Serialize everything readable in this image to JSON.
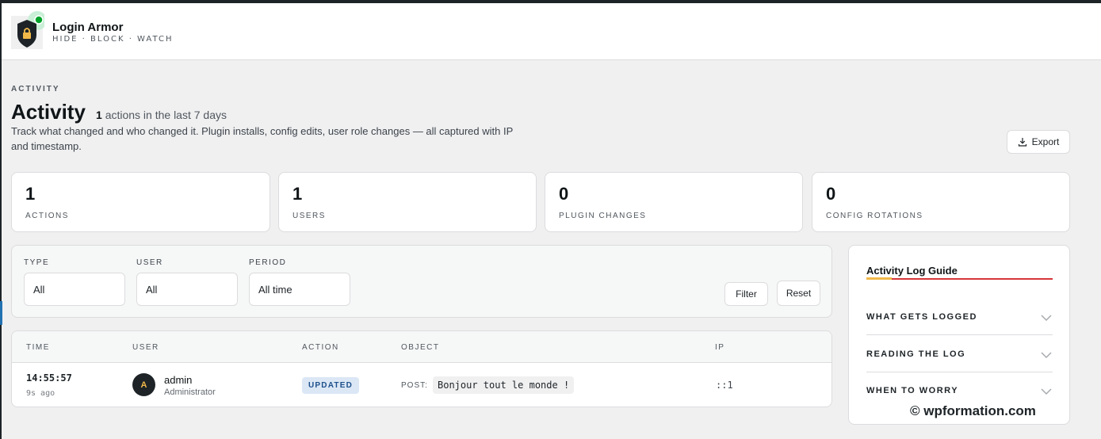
{
  "brand": {
    "name": "Login Armor",
    "tagline": "HIDE · BLOCK · WATCH"
  },
  "page": {
    "eyebrow": "ACTIVITY",
    "title": "Activity",
    "count": "1",
    "count_suffix": "actions in the last 7 days",
    "description": "Track what changed and who changed it. Plugin installs, config edits, user role changes — all captured with IP and timestamp.",
    "export_label": "Export"
  },
  "stats": [
    {
      "value": "1",
      "label": "ACTIONS"
    },
    {
      "value": "1",
      "label": "USERS"
    },
    {
      "value": "0",
      "label": "PLUGIN CHANGES"
    },
    {
      "value": "0",
      "label": "CONFIG ROTATIONS"
    }
  ],
  "filters": {
    "type": {
      "label": "TYPE",
      "value": "All"
    },
    "user": {
      "label": "USER",
      "value": "All"
    },
    "period": {
      "label": "PERIOD",
      "value": "All time"
    },
    "filter_button": "Filter",
    "reset_button": "Reset"
  },
  "table": {
    "headers": {
      "time": "TIME",
      "user": "USER",
      "action": "ACTION",
      "object": "OBJECT",
      "ip": "IP"
    },
    "rows": [
      {
        "time": "14:55:57",
        "ago": "9s ago",
        "avatar": "A",
        "user": "admin",
        "role": "Administrator",
        "action": "UPDATED",
        "object_type": "POST:",
        "object_name": "Bonjour tout le monde !",
        "ip": "::1"
      }
    ]
  },
  "guide": {
    "title": "Activity Log Guide",
    "items": [
      {
        "label": "WHAT GETS LOGGED"
      },
      {
        "label": "READING THE LOG"
      },
      {
        "label": "WHEN TO WORRY"
      }
    ]
  },
  "watermark": "© wpformation.com",
  "colors": {
    "accent_green": "#00a32a",
    "accent_red": "#d63638",
    "accent_gold": "#f0b849",
    "badge_blue": "#dbe7f5"
  },
  "icons": {
    "logo": "shield-lock-icon",
    "export": "download-icon",
    "guide_toggle": "chevron-down-icon"
  }
}
